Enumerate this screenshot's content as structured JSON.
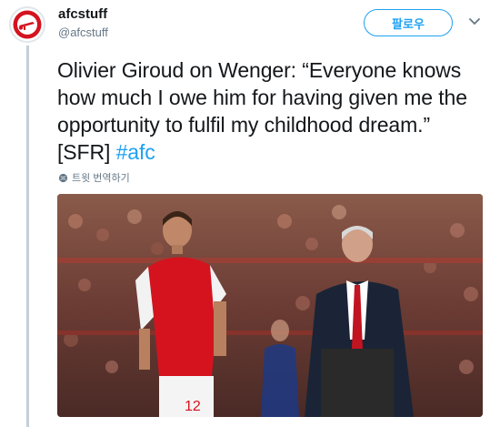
{
  "account": {
    "display_name": "afcstuff",
    "handle": "@afcstuff",
    "avatar_icon": "arsenal-cannon-logo"
  },
  "follow_button": {
    "label": "팔로우"
  },
  "menu": {
    "icon": "chevron-down-icon"
  },
  "tweet": {
    "text": "Olivier Giroud on Wenger: “Everyone knows how much I owe him for having given me the opportunity to fulfil my childhood dream.” [SFR] ",
    "hashtag": "#afc"
  },
  "translate": {
    "label": "트윗 번역하기",
    "icon": "globe-icon"
  },
  "photo": {
    "description_icon": "tweet-photo",
    "shirt_number": "12"
  },
  "colors": {
    "accent": "#1da1f2",
    "arsenal_red": "#d4131f",
    "muted_text": "#657786"
  }
}
